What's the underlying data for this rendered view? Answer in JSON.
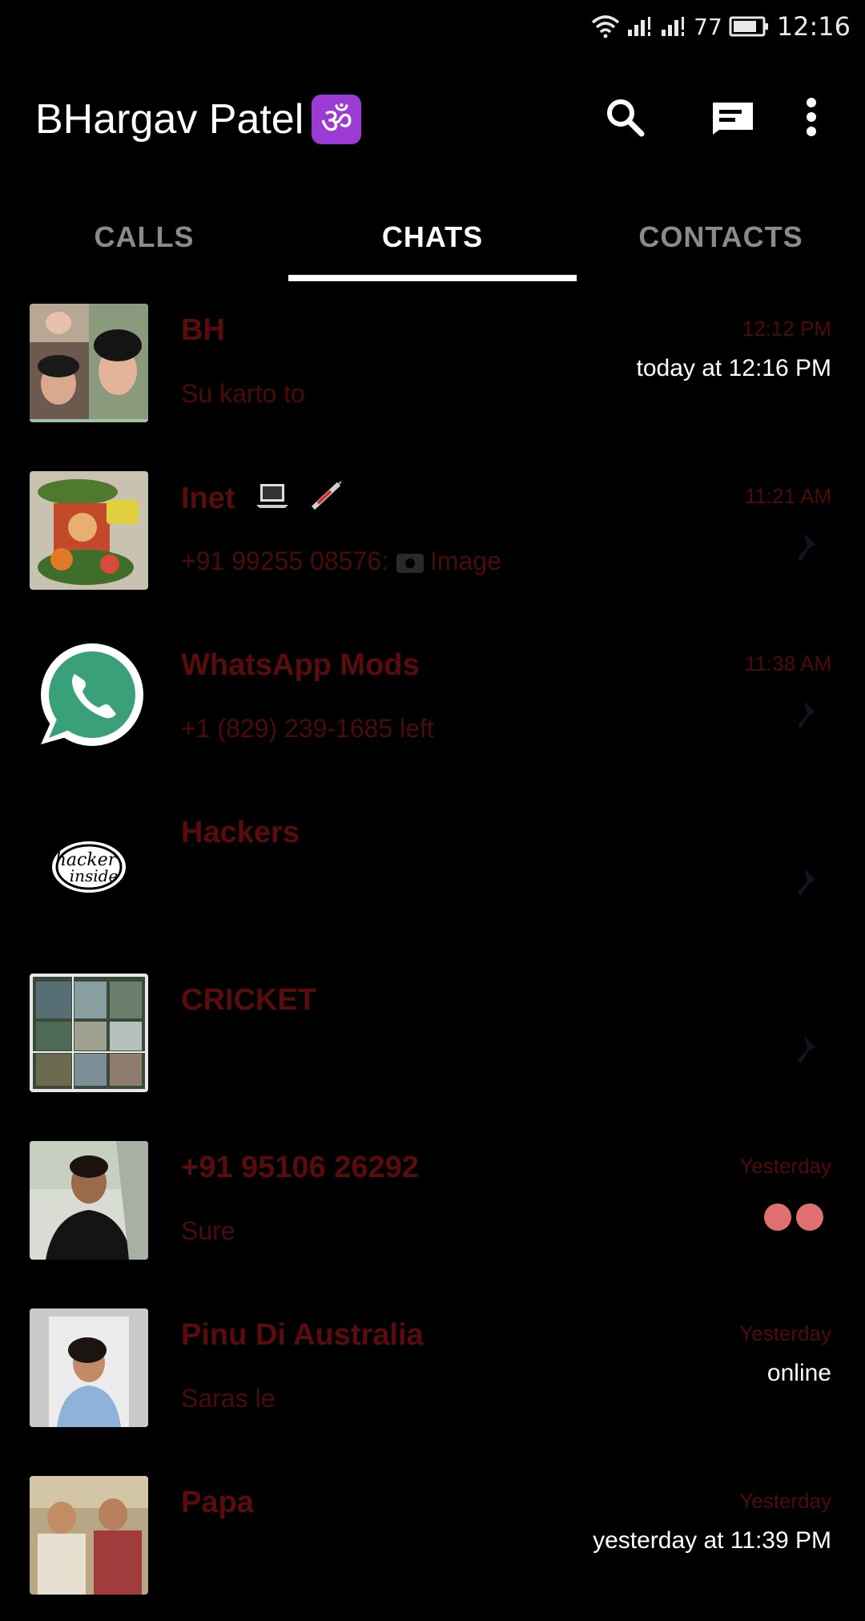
{
  "status_bar": {
    "battery_level": "77",
    "time": "12:16"
  },
  "app_bar": {
    "title": "BHargav Patel",
    "title_emoji": "ॐ",
    "actions": [
      "search-icon",
      "compose-icon",
      "more-vert-icon"
    ]
  },
  "tabs": [
    {
      "label": "CALLS",
      "active": false
    },
    {
      "label": "CHATS",
      "active": true
    },
    {
      "label": "CONTACTS",
      "active": false
    }
  ],
  "colors": {
    "background": "#000000",
    "chat_text": "#5a0c0c",
    "tab_inactive": "#8a8a8a",
    "unread_dot": "#e07070",
    "whatsapp_green": "#3aa07a"
  },
  "chats": [
    {
      "name": "BH",
      "preview": "Su karto to",
      "time": "12:12 PM",
      "status": "today at 12:16 PM",
      "avatar": "photo-collage-avatar"
    },
    {
      "name": "Inet",
      "name_emojis": [
        "laptop-emoji",
        "syringe-emoji"
      ],
      "preview_sender": "+91 99255 08576:",
      "preview": "Image",
      "time": "11:21 AM",
      "avatar": "good-morning-avatar"
    },
    {
      "name": "WhatsApp Mods",
      "preview": "+1 (829) 239-1685 left",
      "time": "11:38 AM",
      "avatar": "whatsapp-logo-avatar"
    },
    {
      "name": "Hackers",
      "preview": "",
      "time": "",
      "avatar": "hacker-inside-avatar",
      "avatar_text_top": "hacker",
      "avatar_text_bottom": "inside"
    },
    {
      "name": "CRICKET",
      "preview": "",
      "time": "",
      "avatar": "cricket-collage-avatar"
    },
    {
      "name": "+91 95106 26292",
      "preview": "Sure",
      "time": "Yesterday",
      "avatar": "person-photo-avatar"
    },
    {
      "name": "Pinu Di Australia",
      "preview": "Saras le",
      "time": "Yesterday",
      "status": "online",
      "avatar": "woman-photo-avatar"
    },
    {
      "name": "Papa",
      "preview": "",
      "time": "Yesterday",
      "status": "yesterday at 11:39 PM",
      "avatar": "family-photo-avatar"
    }
  ]
}
